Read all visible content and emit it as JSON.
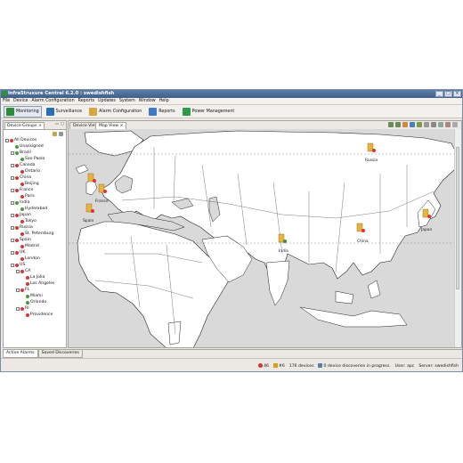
{
  "window": {
    "title": "InfraStruxure Central 6.2.0 : swedishfish",
    "controls": [
      "_",
      "□",
      "×"
    ]
  },
  "menu": [
    "File",
    "Device",
    "Alarm Configuration",
    "Reports",
    "Updates",
    "System",
    "Window",
    "Help"
  ],
  "toolbar": {
    "buttons": [
      {
        "label": "Monitoring",
        "icon": "monitoring-icon",
        "color": "#2e8b3a",
        "active": true
      },
      {
        "label": "Surveillance",
        "icon": "surveillance-icon",
        "color": "#2a6fb5",
        "active": false
      },
      {
        "label": "Alarm Configuration",
        "icon": "alarm-config-icon",
        "color": "#d6a640",
        "active": false
      },
      {
        "label": "Reports",
        "icon": "reports-icon",
        "color": "#3f79c7",
        "active": false
      },
      {
        "label": "Power Management",
        "icon": "power-management-icon",
        "color": "#2f9b4a",
        "active": false
      }
    ]
  },
  "left_panel": {
    "tab": "Device Groups",
    "tab_close": "×",
    "tree": [
      {
        "label": "All Devices",
        "level": 0,
        "expander": "-",
        "status": "red"
      },
      {
        "label": "Unassigned",
        "level": 1,
        "expander": "",
        "status": "green"
      },
      {
        "label": "Brazil",
        "level": 1,
        "expander": "-",
        "status": "green"
      },
      {
        "label": "Sao Paolo",
        "level": 2,
        "expander": "",
        "status": "green"
      },
      {
        "label": "Canada",
        "level": 1,
        "expander": "-",
        "status": "red"
      },
      {
        "label": "Ontario",
        "level": 2,
        "expander": "",
        "status": "red"
      },
      {
        "label": "China",
        "level": 1,
        "expander": "-",
        "status": "red"
      },
      {
        "label": "Beijing",
        "level": 2,
        "expander": "",
        "status": "red"
      },
      {
        "label": "France",
        "level": 1,
        "expander": "-",
        "status": "red"
      },
      {
        "label": "Paris",
        "level": 2,
        "expander": "",
        "status": "red"
      },
      {
        "label": "India",
        "level": 1,
        "expander": "-",
        "status": "green"
      },
      {
        "label": "Hyderabad",
        "level": 2,
        "expander": "",
        "status": "green"
      },
      {
        "label": "Japan",
        "level": 1,
        "expander": "-",
        "status": "red"
      },
      {
        "label": "Tokyo",
        "level": 2,
        "expander": "",
        "status": "red"
      },
      {
        "label": "Russia",
        "level": 1,
        "expander": "-",
        "status": "red"
      },
      {
        "label": "St. Petersburg",
        "level": 2,
        "expander": "",
        "status": "red"
      },
      {
        "label": "Spain",
        "level": 1,
        "expander": "-",
        "status": "red"
      },
      {
        "label": "Madrid",
        "level": 2,
        "expander": "",
        "status": "red"
      },
      {
        "label": "UK",
        "level": 1,
        "expander": "-",
        "status": "red"
      },
      {
        "label": "London",
        "level": 2,
        "expander": "",
        "status": "red"
      },
      {
        "label": "US",
        "level": 1,
        "expander": "-",
        "status": "red"
      },
      {
        "label": "CA",
        "level": 2,
        "expander": "-",
        "status": "red"
      },
      {
        "label": "La Jolla",
        "level": 3,
        "expander": "",
        "status": "red"
      },
      {
        "label": "Los Angeles",
        "level": 3,
        "expander": "",
        "status": "red"
      },
      {
        "label": "FL",
        "level": 2,
        "expander": "-",
        "status": "red"
      },
      {
        "label": "Miami",
        "level": 3,
        "expander": "",
        "status": "green"
      },
      {
        "label": "Orlando",
        "level": 3,
        "expander": "",
        "status": "green"
      },
      {
        "label": "RI",
        "level": 2,
        "expander": "-",
        "status": "red"
      },
      {
        "label": "Providence",
        "level": 3,
        "expander": "",
        "status": "red"
      }
    ]
  },
  "right_panel": {
    "tabs": [
      {
        "label": "Device View",
        "active": false
      },
      {
        "label": "Map View",
        "active": true
      }
    ],
    "tab_close": "×",
    "map_labels": {
      "russia": "Russia",
      "france": "France",
      "spain": "Spain",
      "india": "India",
      "china": "China",
      "japan": "Japan"
    }
  },
  "bottom_tabs": [
    "Active Alarms",
    "Saved Discoveries"
  ],
  "status_bar": {
    "critical_count": "46",
    "warning_count": "#6",
    "devices": "176 devices",
    "discoveries": "0 device discoveries in progress.",
    "user": "User: apc",
    "server": "Server: swedishfish"
  },
  "colors": {
    "critical": "#d33333",
    "warning": "#d4a21a",
    "ok": "#3f8f3a",
    "land": "#ffffff",
    "sea": "#d9d9d9"
  }
}
